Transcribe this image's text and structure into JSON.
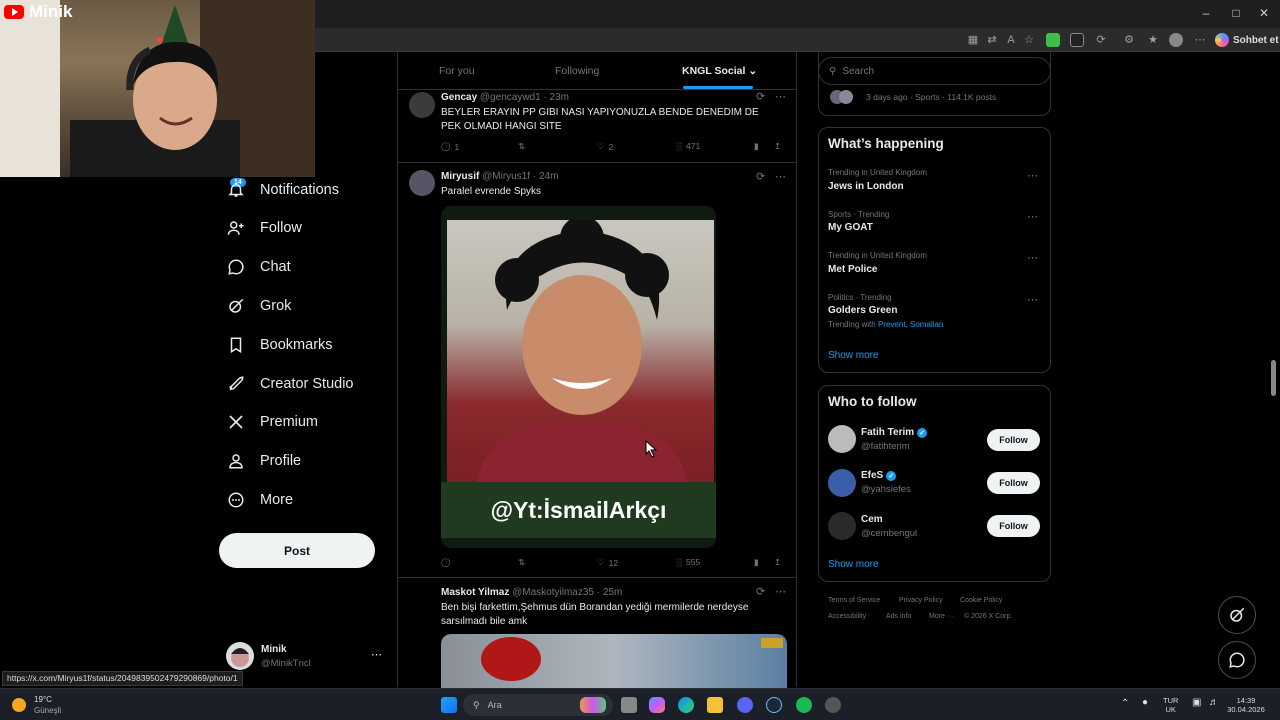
{
  "browser": {
    "copilot_label": "Sohbet et",
    "status_url": "https://x.com/Miryus1f/status/2049839502479290869/photo/1"
  },
  "webcam": {
    "channel_name": "Minik"
  },
  "nav": {
    "notifications_badge": "14",
    "items": [
      {
        "label": "Notifications",
        "icon": "bell-icon"
      },
      {
        "label": "Follow",
        "icon": "person-plus-icon"
      },
      {
        "label": "Chat",
        "icon": "chat-bubble-icon"
      },
      {
        "label": "Grok",
        "icon": "grok-icon"
      },
      {
        "label": "Bookmarks",
        "icon": "bookmark-icon"
      },
      {
        "label": "Creator Studio",
        "icon": "rocket-icon"
      },
      {
        "label": "Premium",
        "icon": "x-logo-icon"
      },
      {
        "label": "Profile",
        "icon": "person-icon"
      },
      {
        "label": "More",
        "icon": "more-circle-icon"
      }
    ],
    "post_label": "Post",
    "account": {
      "name": "Minik",
      "handle": "@MinikTncl"
    }
  },
  "feed": {
    "tabs": [
      "For you",
      "Following",
      "KNGL Social"
    ],
    "active_tab": "KNGL Social",
    "tweets": [
      {
        "name": "Gencay",
        "meta": "@gencaywd1 · 23m",
        "text": "BEYLER ERAYIN PP GIBI NASI YAPIYONUZLA BENDE DENEDIM DE PEK OLMADI HANGI SITE",
        "replies": "1",
        "retweets": "",
        "likes": "2",
        "views": "471"
      },
      {
        "name": "Miryusif",
        "meta": "@Miryus1f · 24m",
        "text": "Paralel evrende Spyks",
        "media_caption": "@Yt:İsmailArkçı",
        "replies": "",
        "retweets": "",
        "likes": "12",
        "views": "555"
      },
      {
        "name": "Maskot Yilmaz",
        "meta": "@Maskotyilmaz35 · 25m",
        "text": "Ben bişi farkettim,Şehmus dün Borandan yediği mermilerde nerdeyse sarsılmadı bile amk"
      }
    ]
  },
  "sidebar_right": {
    "search_placeholder": "Search",
    "top_item_meta": "3 days ago · Sports · 114.1K posts",
    "whats_happening_title": "What’s happening",
    "trends": [
      {
        "meta": "Trending in United Kingdom",
        "name": "Jews in London"
      },
      {
        "meta": "Sports · Trending",
        "name": "My GOAT"
      },
      {
        "meta": "Trending in United Kingdom",
        "name": "Met Police"
      },
      {
        "meta": "Politics · Trending",
        "name": "Golders Green",
        "with_label": "Trending with",
        "with_links": "Prevent, Somalian"
      }
    ],
    "show_more": "Show more",
    "who_to_follow_title": "Who to follow",
    "follow_suggestions": [
      {
        "name": "Fatih Terim",
        "handle": "@fatihterim",
        "verified": true
      },
      {
        "name": "EfeS",
        "handle": "@yahsiefes",
        "verified": true
      },
      {
        "name": "Cem",
        "handle": "@cembengul",
        "verified": false
      }
    ],
    "follow_label": "Follow",
    "footer": [
      "Terms of Service",
      "Privacy Policy",
      "Cookie Policy",
      "Accessibility",
      "Ads info",
      "More ···",
      "© 2026 X Corp."
    ]
  },
  "taskbar": {
    "weather_temp": "19°C",
    "weather_desc": "Güneşli",
    "search_label": "Ara",
    "lang_top": "TUR",
    "lang_bottom": "UK",
    "time": "14:39",
    "date": "30.04.2026"
  }
}
